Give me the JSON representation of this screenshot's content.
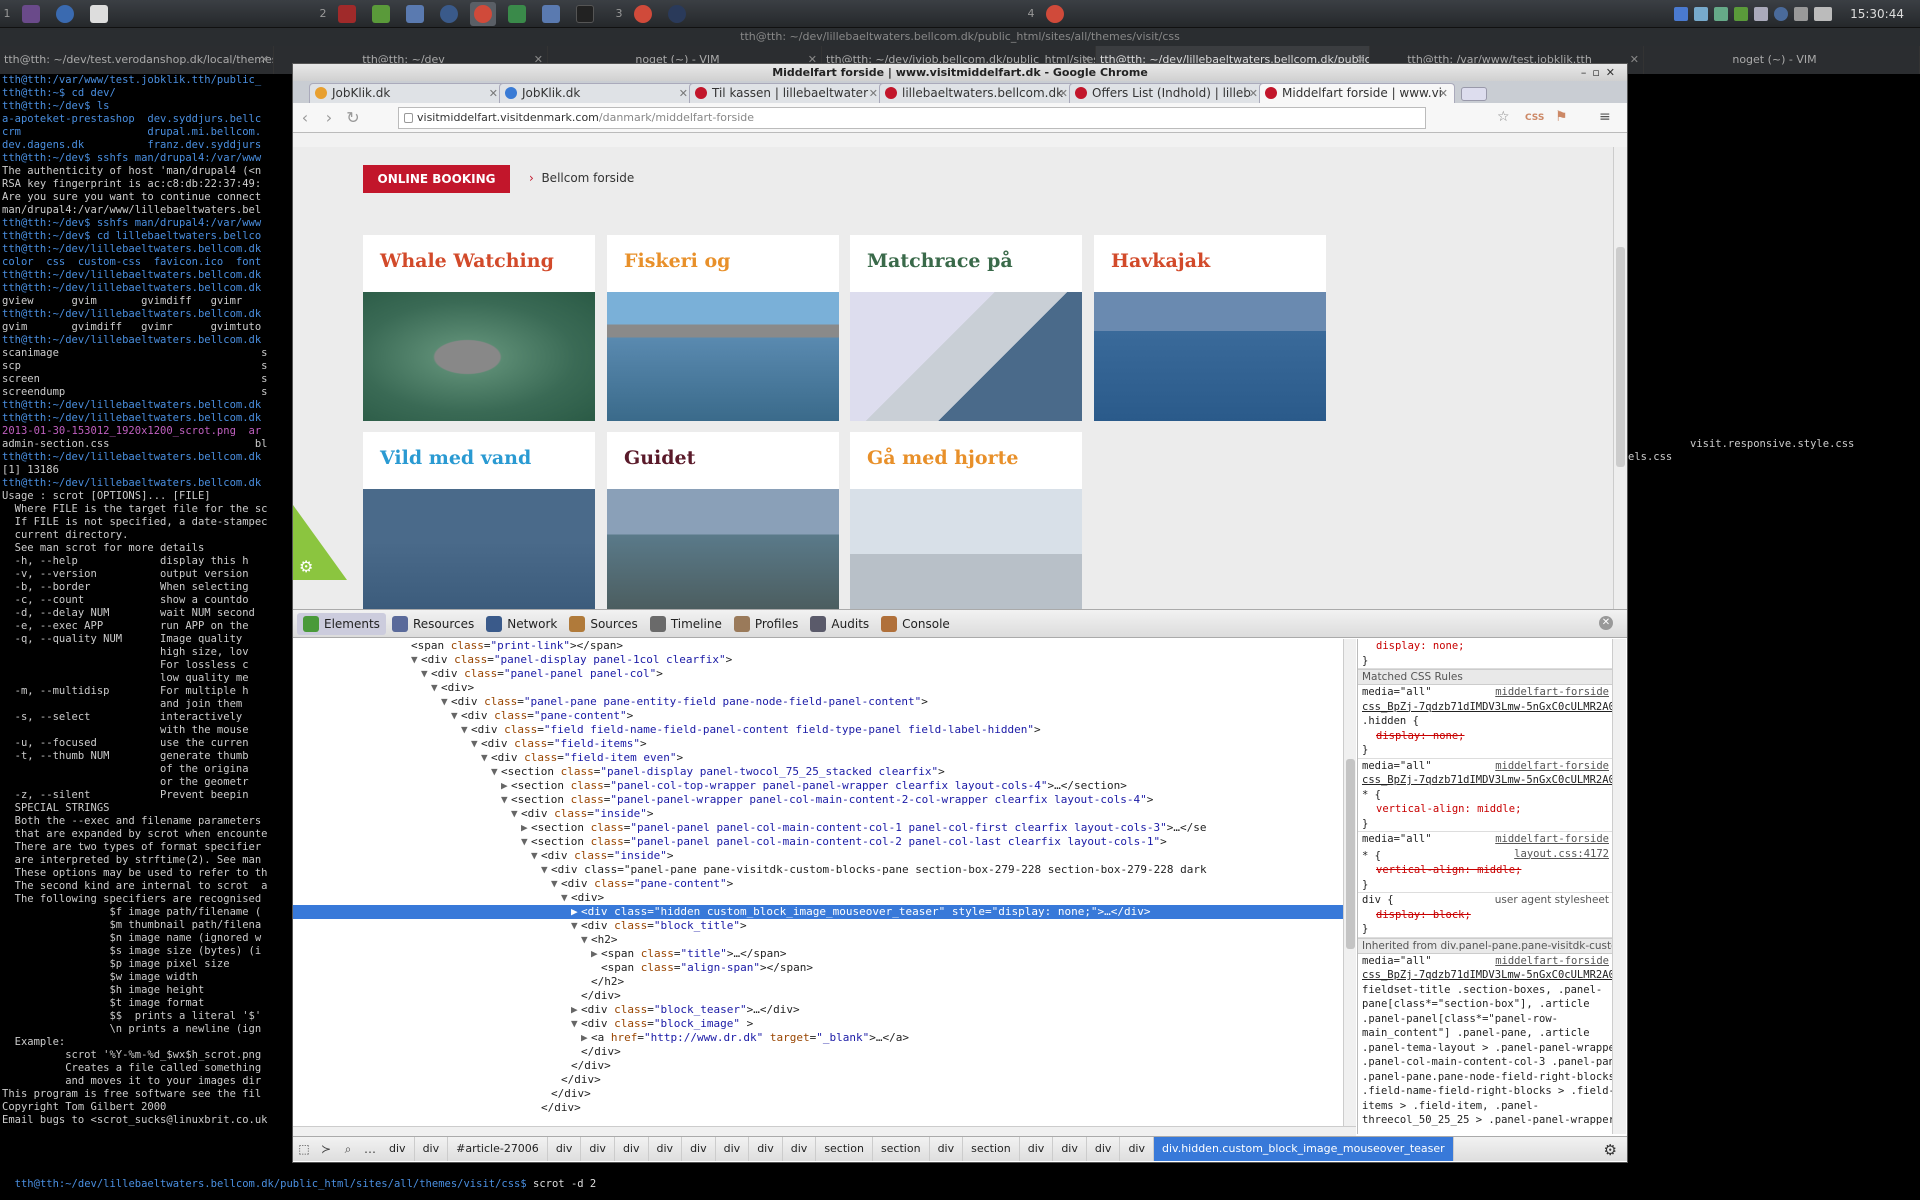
{
  "panel": {
    "workspaces": [
      "1",
      "2",
      "3",
      "4"
    ],
    "clock": "15:30:44"
  },
  "window_title": "tth@tth: ~/dev/lillebaeltwaters.bellcom.dk/public_html/sites/all/themes/visit/css",
  "terminal_tabs": [
    "tth@tth: ~/dev/test.verodanshop.dk/local/themes/ve",
    "tth@tth: ~/dev",
    "noget (~) - VIM",
    "tth@tth: ~/dev/jvjob.bellcom.dk/public_html/sites/all/",
    "tth@tth: ~/dev/lillebaeltwaters.bellcom.dk/public_htn",
    "tth@tth: /var/www/test.jobklik.tth",
    "noget (~) - VIM"
  ],
  "terminal_lines": [
    "tth@tth:/var/www/test.jobklik.tth/public_",
    "tth@tth:~$ cd dev/",
    "tth@tth:~/dev$ ls",
    "a-apoteket-prestashop  dev.syddjurs.bellc",
    "crm                    drupal.mi.bellcom.",
    "dev.dagens.dk          franz.dev.syddjurs",
    "tth@tth:~/dev$ sshfs man/drupal4:/var/www",
    "The authenticity of host 'man/drupal4 (<n",
    "RSA key fingerprint is ac:c8:db:22:37:49:",
    "Are you sure you want to continue connect",
    "man/drupal4:/var/www/lillebaeltwaters.bel",
    "tth@tth:~/dev$ sshfs man/drupal4:/var/www",
    "tth@tth:~/dev$ cd lillebaeltwaters.bellco",
    "tth@tth:~/dev/lillebaeltwaters.bellcom.dk",
    "color  css  custom-css  favicon.ico  font",
    "tth@tth:~/dev/lillebaeltwaters.bellcom.dk",
    "tth@tth:~/dev/lillebaeltwaters.bellcom.dk",
    "gview      gvim       gvimdiff   gvimr",
    "tth@tth:~/dev/lillebaeltwaters.bellcom.dk",
    "gvim       gvimdiff   gvimr      gvimtuto",
    "tth@tth:~/dev/lillebaeltwaters.bellcom.dk",
    "scanimage                                s",
    "scp                                      s",
    "screen                                   s",
    "screendump                               s",
    "tth@tth:~/dev/lillebaeltwaters.bellcom.dk",
    "tth@tth:~/dev/lillebaeltwaters.bellcom.dk",
    "2013-01-30-153012_1920x1200_scrot.png  ar",
    "admin-section.css                       bl",
    "tth@tth:~/dev/lillebaeltwaters.bellcom.dk",
    "[1] 13186",
    "tth@tth:~/dev/lillebaeltwaters.bellcom.dk",
    "Usage : scrot [OPTIONS]... [FILE]",
    "  Where FILE is the target file for the sc",
    "  If FILE is not specified, a date-stampec",
    "  current directory.",
    "  See man scrot for more details",
    "  -h, --help             display this h",
    "  -v, --version          output version",
    "  -b, --border           When selecting",
    "  -c, --count            show a countdo",
    "  -d, --delay NUM        wait NUM second",
    "  -e, --exec APP         run APP on the",
    "  -q, --quality NUM      Image quality",
    "                         high size, lov",
    "                         For lossless c",
    "                         low quality me",
    "  -m, --multidisp        For multiple h",
    "                         and join them",
    "  -s, --select           interactively",
    "                         with the mouse",
    "  -u, --focused          use the curren",
    "  -t, --thumb NUM        generate thumb",
    "                         of the origina",
    "                         or the geometr",
    "  -z, --silent           Prevent beepin",
    "",
    "  SPECIAL STRINGS",
    "  Both the --exec and filename parameters",
    "  that are expanded by scrot when encounte",
    "  There are two types of format specifier",
    "  are interpreted by strftime(2). See man",
    "  These options may be used to refer to th",
    "  The second kind are internal to scrot  a",
    "  The following specifiers are recognised",
    "                 $f image path/filename (",
    "                 $m thumbnail path/filena",
    "                 $n image name (ignored w",
    "                 $s image size (bytes) (i",
    "                 $p image pixel size",
    "                 $w image width",
    "                 $h image height",
    "                 $t image format",
    "                 $$  prints a literal '$'",
    "                 \\n prints a newline (ign",
    "  Example:",
    "          scrot '%Y-%m-%d_$wx$h_scrot.png",
    "          Creates a file called something",
    "          and moves it to your images dir",
    "",
    "This program is free software see the fil",
    "Copyright Tom Gilbert 2000",
    "Email bugs to <scrot_sucks@linuxbrit.co.uk"
  ],
  "terminal_bottom": {
    "prompt": "tth@tth:~/dev/lillebaeltwaters.bellcom.dk/public_html/sites/all/themes/visit/css$",
    "command": " scrot -d 2"
  },
  "right_terminal": {
    "line1": "visit.responsive.style.css",
    "line2": "els.css"
  },
  "browser": {
    "title": "Middelfart forside | www.visitmiddelfart.dk - Google Chrome",
    "tabs": [
      {
        "label": "JobKlik.dk",
        "color": "#e8a030"
      },
      {
        "label": "JobKlik.dk",
        "color": "#3a7bd5"
      },
      {
        "label": "Til kassen | lillebaeltwater",
        "color": "#c2162b"
      },
      {
        "label": "lillebaeltwaters.bellcom.dk",
        "color": "#c2162b"
      },
      {
        "label": "Offers List (Indhold) | lilleb",
        "color": "#c2162b"
      },
      {
        "label": "Middelfart forside | www.vi",
        "color": "#c2162b"
      }
    ],
    "url_host": "visitmiddelfart.visitdenmark.com",
    "url_path": "/danmark/middelfart-forside",
    "css_ext_label": "CSS"
  },
  "site": {
    "booking_label": "ONLINE BOOKING",
    "bellcom_label": "Bellcom forside",
    "cards": [
      {
        "title": "Whale Watching",
        "color": "#d24a2a",
        "img": "dolphin"
      },
      {
        "title": "Fiskeri og strandsjov",
        "color": "#e8902a",
        "img": "fishing"
      },
      {
        "title": "Matchrace på Lillebælt",
        "color": "#3a6a4a",
        "img": "sailing"
      },
      {
        "title": "Havkajak",
        "color": "#d24a2a",
        "img": "kayak"
      },
      {
        "title": "Vild med vand",
        "color": "#2a9ad2",
        "img": "kid-kayak"
      },
      {
        "title": "Guidet undervandsjagt",
        "color": "#5a1a2a",
        "img": "diving"
      },
      {
        "title": "Gå med hjorte",
        "color": "#e8902a",
        "img": "deer"
      }
    ]
  },
  "devtools": {
    "tabs": [
      "Elements",
      "Resources",
      "Network",
      "Sources",
      "Timeline",
      "Profiles",
      "Audits",
      "Console"
    ],
    "elements": [
      {
        "i": 0,
        "t": "<span class=\"print-link\"></span>"
      },
      {
        "i": 1,
        "a": "▼",
        "t": "<div class=\"panel-display panel-1col clearfix\">"
      },
      {
        "i": 2,
        "a": "▼",
        "t": "<div class=\"panel-panel panel-col\">"
      },
      {
        "i": 3,
        "a": "▼",
        "t": "<div>"
      },
      {
        "i": 4,
        "a": "▼",
        "t": "<div class=\"panel-pane pane-entity-field pane-node-field-panel-content\">"
      },
      {
        "i": 5,
        "a": "▼",
        "t": "<div class=\"pane-content\">"
      },
      {
        "i": 6,
        "a": "▼",
        "t": "<div class=\"field field-name-field-panel-content field-type-panel field-label-hidden\">"
      },
      {
        "i": 7,
        "a": "▼",
        "t": "<div class=\"field-items\">"
      },
      {
        "i": 8,
        "a": "▼",
        "t": "<div class=\"field-item even\">"
      },
      {
        "i": 9,
        "a": "▼",
        "t": "<section class=\"panel-display panel-twocol_75_25_stacked clearfix\">"
      },
      {
        "i": 10,
        "a": "▶",
        "t": "<section class=\"panel-col-top-wrapper panel-panel-wrapper clearfix layout-cols-4\">…</section>"
      },
      {
        "i": 10,
        "a": "▼",
        "t": "<section class=\"panel-panel-wrapper panel-col-main-content-2-col-wrapper clearfix layout-cols-4\">"
      },
      {
        "i": 11,
        "a": "▼",
        "t": "<div class=\"inside\">"
      },
      {
        "i": 12,
        "a": "▶",
        "t": "<section class=\"panel-panel panel-col-main-content-col-1 panel-col-first clearfix layout-cols-3\">…</se"
      },
      {
        "i": 12,
        "a": "▼",
        "t": "<section class=\"panel-panel panel-col-main-content-col-2 panel-col-last clearfix layout-cols-1\">"
      },
      {
        "i": 13,
        "a": "▼",
        "t": "<div class=\"inside\">"
      },
      {
        "i": 14,
        "a": "▼",
        "t": "<div class=\"panel-pane pane-visitdk-custom-blocks-pane section-box-279-228 section-box-279-228 dark"
      },
      {
        "i": 15,
        "a": "▼",
        "t": "<div class=\"pane-content\">"
      },
      {
        "i": 16,
        "a": "▼",
        "t": "<div>"
      },
      {
        "i": 17,
        "a": "▶",
        "t": "<div class=\"hidden custom_block_image_mouseover_teaser\" style=\"display: none;\">…</div>",
        "sel": true
      },
      {
        "i": 17,
        "a": "▼",
        "t": "<div class=\"block_title\">"
      },
      {
        "i": 18,
        "a": "▼",
        "t": "<h2>"
      },
      {
        "i": 19,
        "a": "▶",
        "t": "<span class=\"title\">…</span>"
      },
      {
        "i": 19,
        "t": "<span class=\"align-span\"></span>"
      },
      {
        "i": 18,
        "t": "</h2>"
      },
      {
        "i": 17,
        "t": "</div>"
      },
      {
        "i": 17,
        "a": "▶",
        "t": "<div class=\"block_teaser\">…</div>"
      },
      {
        "i": 17,
        "a": "▼",
        "t": "<div class=\"block_image\" >"
      },
      {
        "i": 18,
        "a": "▶",
        "t": "<a href=\"http://www.dr.dk\" target=\"_blank\">…</a>"
      },
      {
        "i": 17,
        "t": "</div>"
      },
      {
        "i": 16,
        "t": "</div>"
      },
      {
        "i": 15,
        "t": "</div>"
      },
      {
        "i": 14,
        "t": "</div>"
      },
      {
        "i": 13,
        "t": "</div>"
      }
    ],
    "styles": {
      "top_rule": "display: none;",
      "matched_header": "Matched CSS Rules",
      "media": "media=\"all\"",
      "src1": "middelfart-forside",
      "css1": "css_BpZj-7qdzb71dIMDV3Lmw-5nGxC0cULMR2A0cJS",
      "sel1": ".hidden {",
      "prop1": "display: none;",
      "sel2": "* {",
      "prop2": "vertical-align: middle;",
      "src3": "layout.css:4172",
      "prop3": "vertical-align: middle;",
      "ua_sel": "div {",
      "ua_label": "user agent stylesheet",
      "ua_prop": "display: block;",
      "inherited": "Inherited from div.panel-pane.pane-visitdk-custom",
      "long1": "fieldset-title .section-boxes, .panel-",
      "long2": "pane[class*=\"section-box\"], .article",
      "long3": ".panel-panel[class*=\"panel-row-",
      "long4": "main_content\"] .panel-pane, .article",
      "long5": ".panel-tema-layout > .panel-panel-wrapper >",
      "long6": ".panel-col-main-content-col-3 .panel-pane,",
      "long7": ".panel-pane.pane-node-field-right-blocks",
      "long8": ".field-name-field-right-blocks > .field-",
      "long9": "items > .field-item, .panel-",
      "long10": "threecol_50_25_25 > .panel-panel-wrapper >",
      "close": "}"
    },
    "breadcrumbs": [
      "div",
      "div",
      "#article-27006",
      "div",
      "div",
      "div",
      "div",
      "div",
      "div",
      "div",
      "div",
      "section",
      "section",
      "div",
      "section",
      "div",
      "div",
      "div",
      "div"
    ],
    "breadcrumb_active": "div.hidden.custom_block_image_mouseover_teaser"
  }
}
